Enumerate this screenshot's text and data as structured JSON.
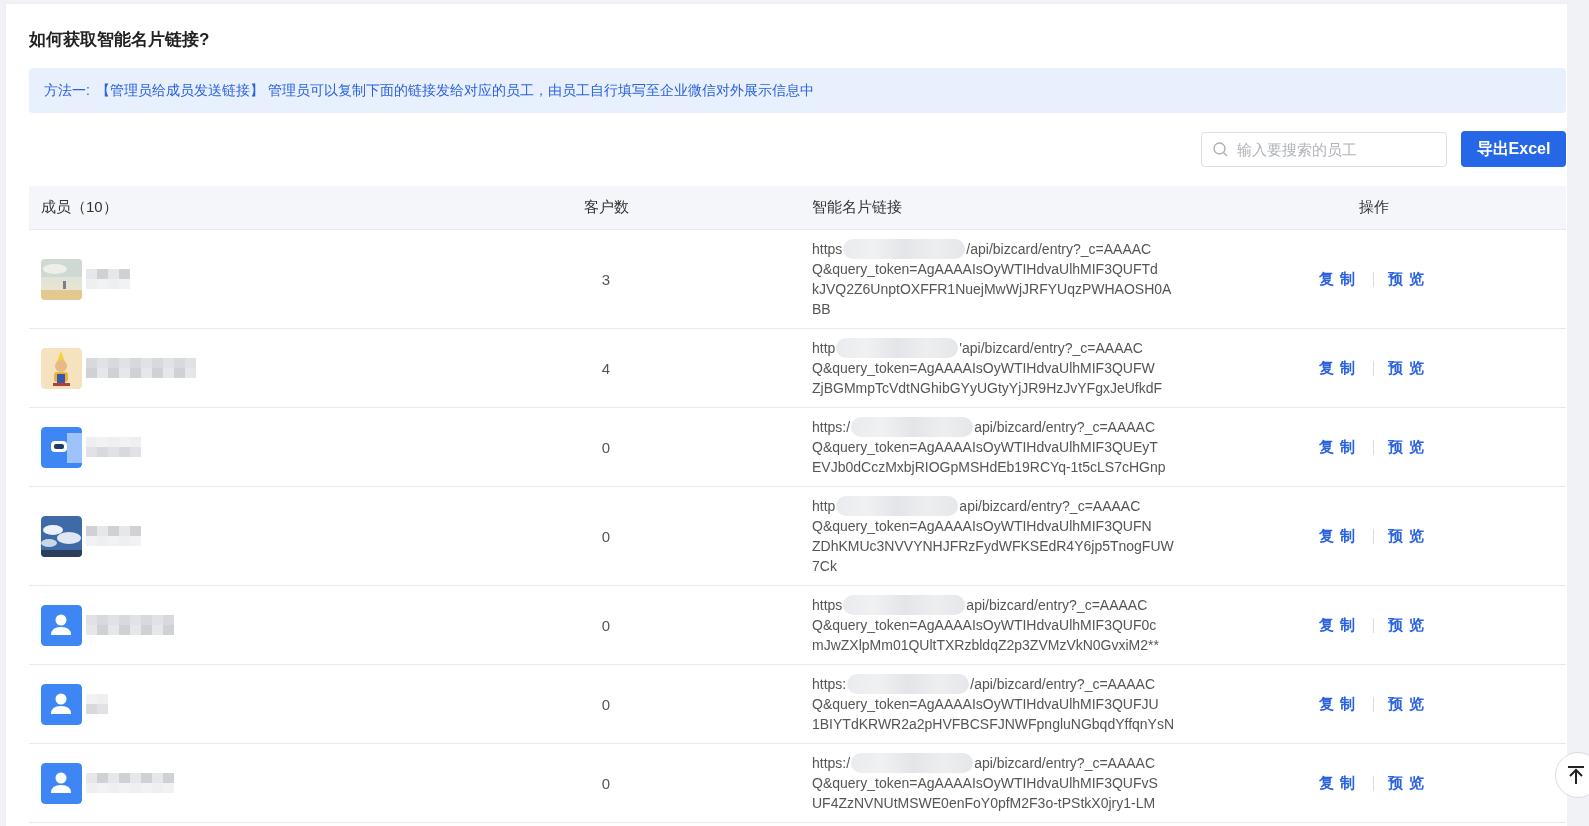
{
  "title": "如何获取智能名片链接?",
  "notice": {
    "label": "方法一:",
    "highlight": "【管理员给成员发送链接】",
    "text": "管理员可以复制下面的链接发给对应的员工，由员工自行填写至企业微信对外展示信息中"
  },
  "search": {
    "placeholder": "输入要搜索的员工"
  },
  "export_button": "导出Excel",
  "table": {
    "columns": [
      "成员（10）",
      "客户数",
      "智能名片链接",
      "操作"
    ],
    "rows": [
      {
        "kind": "beach",
        "customers": "3",
        "link": {
          "start": "https",
          "end": "/api/bizcard/entry?_c=AAAAC",
          "lines": [
            "Q&query_token=AgAAAAIsOyWTIHdvaUlhMIF3QUFTd",
            "kJVQ2Z6UnptOXFFR1NuejMwWjJRFYUqzPWHAOSH0A",
            "BB"
          ]
        },
        "actions": [
          "复制",
          "预览"
        ]
      },
      {
        "kind": "cartoon",
        "customers": "4",
        "link": {
          "start": "http",
          "end": "'api/bizcard/entry?_c=AAAAC",
          "lines": [
            "Q&query_token=AgAAAAIsOyWTIHdvaUlhMIF3QUFW",
            "ZjBGMmpTcVdtNGhibGYyUGtyYjJR9HzJvYFgxJeUfkdF"
          ]
        },
        "actions": [
          "复制",
          "预览"
        ]
      },
      {
        "kind": "robot",
        "customers": "0",
        "link": {
          "start": "https:/",
          "end": "api/bizcard/entry?_c=AAAAC",
          "lines": [
            "Q&query_token=AgAAAAIsOyWTIHdvaUlhMIF3QUEyT",
            "EVJb0dCczMxbjRIOGpMSHdEb19RCYq-1t5cLS7cHGnp"
          ]
        },
        "actions": [
          "复制",
          "预览"
        ]
      },
      {
        "kind": "sky",
        "customers": "0",
        "link": {
          "start": "http",
          "end": "api/bizcard/entry?_c=AAAAC",
          "lines": [
            "Q&query_token=AgAAAAIsOyWTIHdvaUlhMIF3QUFN",
            "ZDhKMUc3NVVYNHJFRzFydWFKSEdR4Y6jp5TnogFUW",
            "7Ck"
          ]
        },
        "actions": [
          "复制",
          "预览"
        ]
      },
      {
        "kind": "person",
        "customers": "0",
        "link": {
          "start": "https",
          "end": "api/bizcard/entry?_c=AAAAC",
          "lines": [
            "Q&query_token=AgAAAAIsOyWTIHdvaUlhMIF3QUF0c",
            "mJwZXlpMm01QUltTXRzbldqZ2p3ZVMzVkN0GvxiM2**"
          ]
        },
        "actions": [
          "复制",
          "预览"
        ]
      },
      {
        "kind": "person",
        "customers": "0",
        "link": {
          "start": "https:",
          "end": "/api/bizcard/entry?_c=AAAAC",
          "lines": [
            "Q&query_token=AgAAAAIsOyWTIHdvaUlhMIF3QUFJU",
            "1BIYTdKRWR2a2pHVFBCSFJNWFpngluNGbqdYffqnYsN"
          ]
        },
        "actions": [
          "复制",
          "预览"
        ]
      },
      {
        "kind": "person",
        "customers": "0",
        "link": {
          "start": "https:/",
          "end": "api/bizcard/entry?_c=AAAAC",
          "lines": [
            "Q&query_token=AgAAAAIsOyWTIHdvaUlhMIF3QUFvS",
            "UF4ZzNVNUtMSWE0enFoY0pfM2F3o-tPStkX0jry1-LM"
          ]
        },
        "actions": [
          "复制",
          "预览"
        ]
      }
    ]
  }
}
